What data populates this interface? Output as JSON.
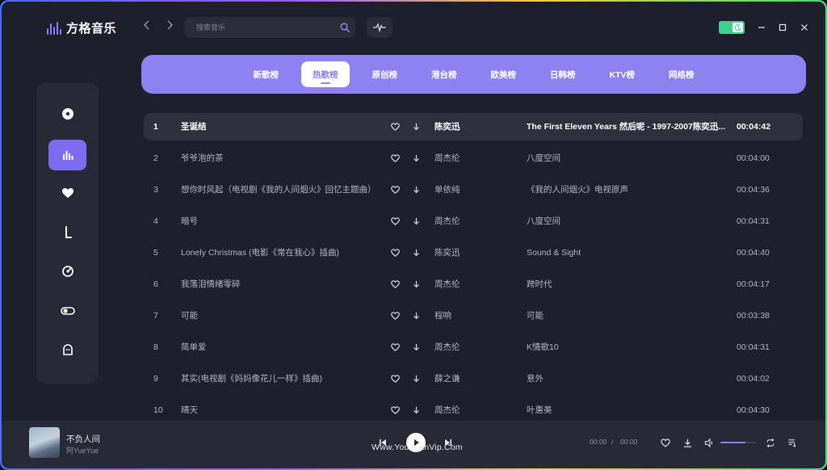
{
  "app": {
    "name": "方格音乐"
  },
  "search": {
    "placeholder": "搜索音乐"
  },
  "tabs": [
    {
      "label": "新歌榜",
      "active": false
    },
    {
      "label": "热歌榜",
      "active": true
    },
    {
      "label": "原创榜",
      "active": false
    },
    {
      "label": "港台榜",
      "active": false
    },
    {
      "label": "欧美榜",
      "active": false
    },
    {
      "label": "日韩榜",
      "active": false
    },
    {
      "label": "KTV榜",
      "active": false
    },
    {
      "label": "网络榜",
      "active": false
    }
  ],
  "sidebar": {
    "items": [
      {
        "icon": "disc-icon",
        "active": false
      },
      {
        "icon": "chart-bars-icon",
        "active": true
      },
      {
        "icon": "heart-icon",
        "active": false
      },
      {
        "icon": "download-icon",
        "active": false
      },
      {
        "icon": "radar-icon",
        "active": false
      },
      {
        "icon": "toggle-icon",
        "active": false
      },
      {
        "icon": "ghost-icon",
        "active": false
      }
    ]
  },
  "songs": [
    {
      "num": "1",
      "title": "圣诞结",
      "artist": "陈奕迅",
      "album": "The First Eleven Years 然后呢 - 1997-2007陈奕迅...",
      "duration": "00:04:42"
    },
    {
      "num": "2",
      "title": "爷爷泡的茶",
      "artist": "周杰伦",
      "album": "八度空间",
      "duration": "00:04:00"
    },
    {
      "num": "3",
      "title": "想你时风起（电视剧《我的人间烟火》回忆主题曲）",
      "artist": "单依纯",
      "album": "《我的人间烟火》电视原声",
      "duration": "00:04:36"
    },
    {
      "num": "4",
      "title": "暗号",
      "artist": "周杰伦",
      "album": "八度空间",
      "duration": "00:04:31"
    },
    {
      "num": "5",
      "title": "Lonely Christmas (电影《常在我心》插曲)",
      "artist": "陈奕迅",
      "album": "Sound & Sight",
      "duration": "00:04:40"
    },
    {
      "num": "6",
      "title": "我落泪情绪零碎",
      "artist": "周杰伦",
      "album": "跨时代",
      "duration": "00:04:17"
    },
    {
      "num": "7",
      "title": "可能",
      "artist": "程响",
      "album": "可能",
      "duration": "00:03:38"
    },
    {
      "num": "8",
      "title": "简单爱",
      "artist": "周杰伦",
      "album": "K情歌10",
      "duration": "00:04:31"
    },
    {
      "num": "9",
      "title": "其实(电视剧《妈妈像花儿一样》插曲)",
      "artist": "薛之谦",
      "album": "意外",
      "duration": "00:04:02"
    },
    {
      "num": "10",
      "title": "晴天",
      "artist": "周杰伦",
      "album": "叶惠美",
      "duration": "00:04:30"
    }
  ],
  "player": {
    "track_name": "不负人间",
    "artist": "阿YueYue",
    "current_time": "00:00",
    "separator": "/",
    "total_time": "00:00",
    "watermark": "Www.YouYuanVip.Com",
    "volume": 0.7
  },
  "colors": {
    "accent": "#8e82f0",
    "active_rail": "#7c6cf0",
    "toggle": "#3fcf8e",
    "background": "#1e1f2a"
  }
}
